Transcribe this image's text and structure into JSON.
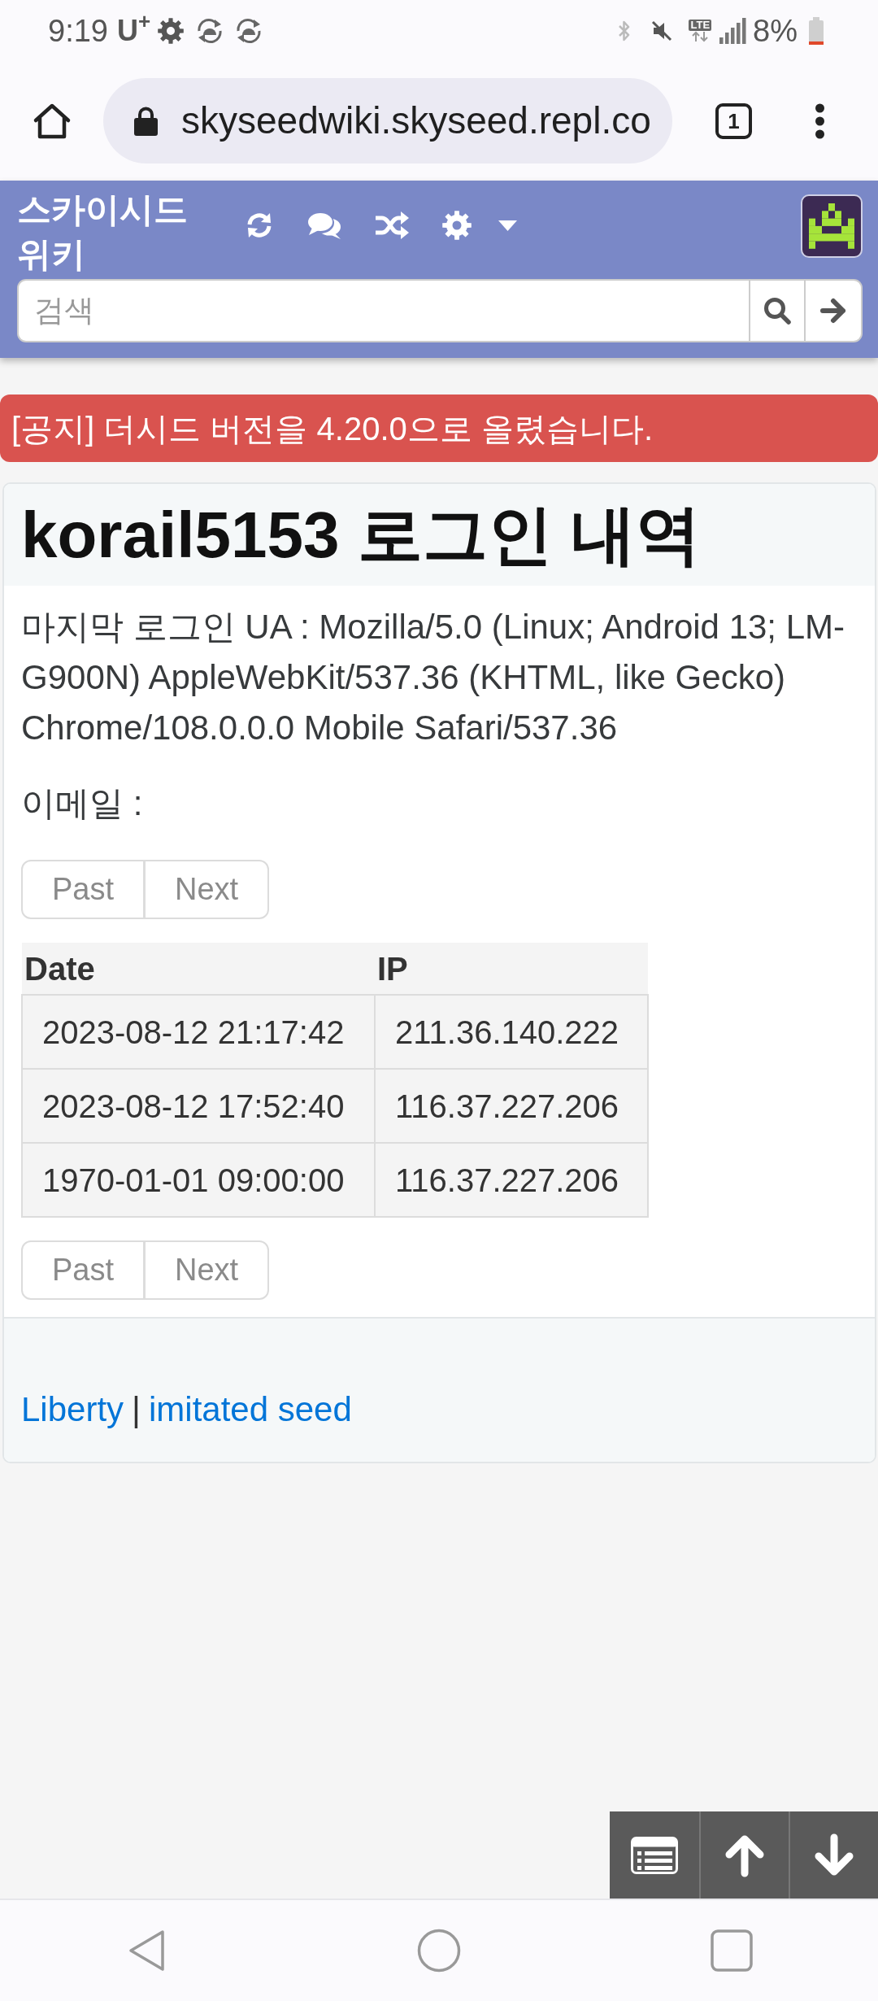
{
  "status_bar": {
    "time": "9:19",
    "carrier": "U$^{+}$",
    "network": "LTE",
    "battery": "8%"
  },
  "browser": {
    "url": "skyseedwiki.skyseed.repl.co",
    "tab_count": "1"
  },
  "navbar": {
    "brand": "스카이시드 위키",
    "search": {
      "placeholder": "검색"
    }
  },
  "notice": "[공지] 더시드 버전을 4.20.0으로 올렸습니다.",
  "page": {
    "title": "korail5153 로그인 내역",
    "user_agent": "마지막 로그인 UA : Mozilla/5.0 (Linux; Android 13; LM-G900N) AppleWebKit/537.36 (KHTML, like Gecko) Chrome/108.0.0.0 Mobile Safari/537.36",
    "email": "이메일 :",
    "pagination_top": [
      {
        "label": "Past",
        "disabled": true
      },
      {
        "label": "Next",
        "disabled": true
      }
    ],
    "table": {
      "columns": [
        "Date",
        "IP"
      ],
      "rows": [
        [
          "2023-08-12 21:17:42",
          "211.36.140.222"
        ],
        [
          "2023-08-12 17:52:40",
          "116.37.227.206"
        ],
        [
          "1970-01-01 09:00:00",
          "116.37.227.206"
        ]
      ]
    },
    "pagination_bottom": [
      {
        "label": "Past",
        "disabled": true
      },
      {
        "label": "Next",
        "disabled": true
      }
    ]
  },
  "footer": {
    "links": [
      {
        "label": "Liberty"
      },
      {
        "label": "imitated seed"
      }
    ],
    "separator": "|"
  }
}
